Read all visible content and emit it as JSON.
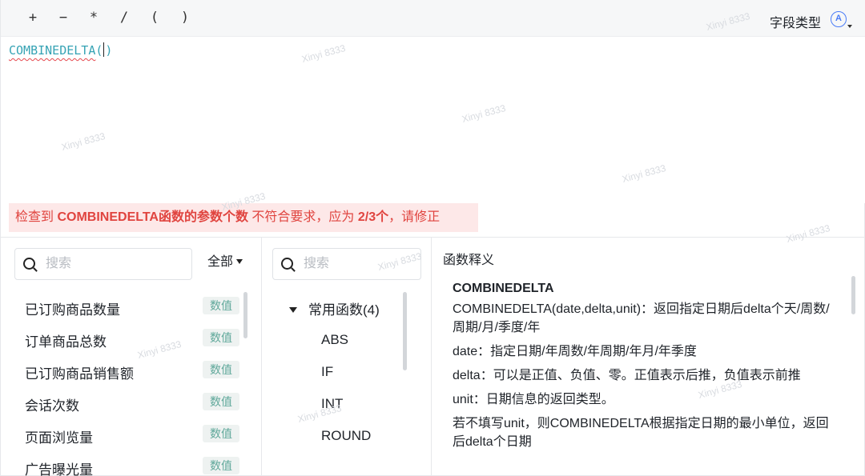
{
  "toolbar": {
    "operators": [
      "+",
      "−",
      "*",
      "/",
      "(",
      ")"
    ],
    "field_type_label": "字段类型",
    "type_badge": "A"
  },
  "editor": {
    "function_name": "COMBINEDELTA",
    "open_paren": "(",
    "close_paren": ")"
  },
  "error": {
    "prefix": "检查到 ",
    "fn_name": "COMBINEDELTA",
    "mid": "函数的参数个数",
    "middle_text": " 不符合要求，应为 ",
    "expected": "2/3个",
    "suffix": "，请修正"
  },
  "fields_panel": {
    "search_placeholder": "搜索",
    "filter_label": "全部",
    "items": [
      {
        "name": "已订购商品数量",
        "tag": "数值"
      },
      {
        "name": "订单商品总数",
        "tag": "数值"
      },
      {
        "name": "已订购商品销售额",
        "tag": "数值"
      },
      {
        "name": "会话次数",
        "tag": "数值"
      },
      {
        "name": "页面浏览量",
        "tag": "数值"
      },
      {
        "name": "广告曝光量",
        "tag": "数值"
      }
    ]
  },
  "functions_panel": {
    "search_placeholder": "搜索",
    "group_label": "常用函数(4)",
    "functions": [
      "ABS",
      "IF",
      "INT",
      "ROUND"
    ]
  },
  "doc_panel": {
    "title": "函数释义",
    "heading": "COMBINEDELTA",
    "paragraphs": [
      "COMBINEDELTA(date,delta,unit)：返回指定日期后delta个天/周数/周期/月/季度/年",
      "date：指定日期/年周数/年周期/年月/年季度",
      "delta：可以是正值、负值、零。正值表示后推，负值表示前推",
      "unit：日期信息的返回类型。",
      "若不填写unit，则COMBINEDELTA根据指定日期的最小单位，返回后delta个日期"
    ]
  },
  "watermark": "Xinyi 8333",
  "colors": {
    "accent": "#4a7cf7",
    "code": "#36a3b4",
    "error_text": "#e0443f",
    "error_bg": "#fde8e8",
    "tag_text": "#5fa89a"
  }
}
